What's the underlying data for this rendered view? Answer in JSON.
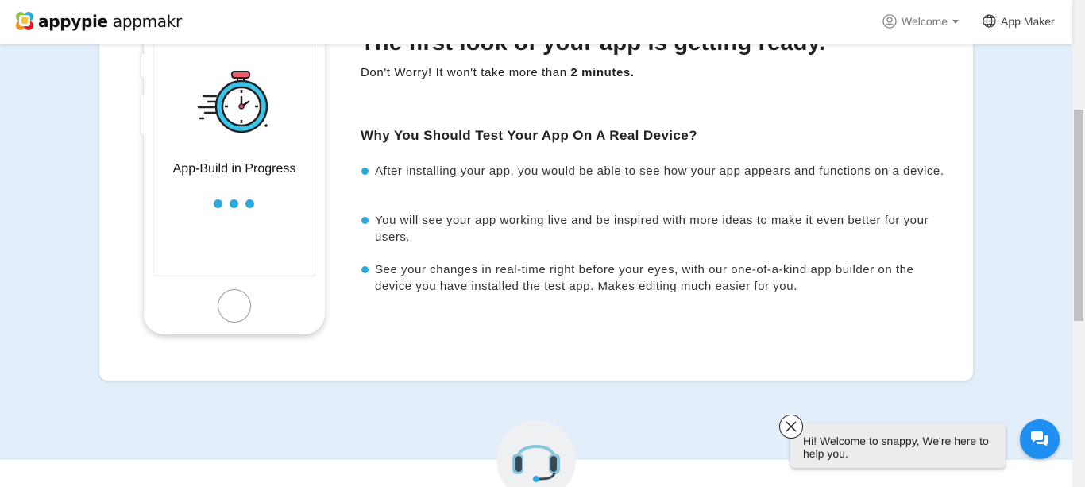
{
  "header": {
    "logo_bold": "appypie",
    "logo_rest": " appmakr",
    "welcome_label": "Welcome",
    "app_maker_label": "App Maker"
  },
  "phone": {
    "status_label": "App-Build in Progress"
  },
  "content": {
    "headline": "The first look of your app is getting ready.",
    "sub_prefix": "Don't Worry! It won't take more than ",
    "sub_bold": "2 minutes.",
    "why_title": "Why You Should Test Your App On A Real Device?",
    "bullets": [
      "After installing your app, you would be able to see how your app appears and functions on a device.",
      "You will see your app working live and be inspired with more ideas to make it even better for your users.",
      "See your changes in real-time right before your eyes, with our one-of-a-kind app builder on the device you have installed the test app. Makes editing much easier for you."
    ]
  },
  "chat": {
    "message": "Hi! Welcome to snappy, We're here to help you."
  },
  "colors": {
    "page_bg": "#e3eefb",
    "accent": "#2aa9e0",
    "chat_button": "#1f8ef1"
  },
  "icons": {
    "user": "user-circle-icon",
    "globe": "globe-icon",
    "stopwatch": "stopwatch-icon",
    "headset": "headset-icon",
    "close": "close-icon",
    "chat": "chat-bubbles-icon"
  }
}
